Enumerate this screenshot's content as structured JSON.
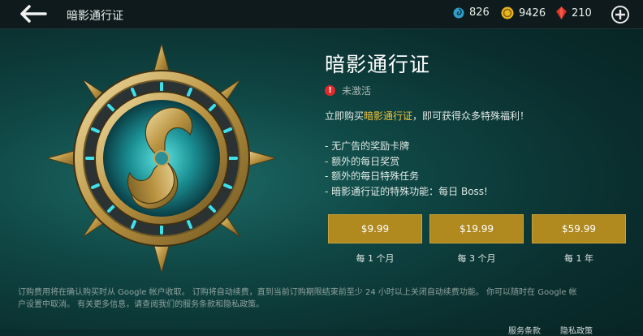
{
  "header": {
    "title": "暗影通行证",
    "currencies": [
      {
        "icon": "blue-swirl-icon",
        "value": "826"
      },
      {
        "icon": "gold-coin-icon",
        "value": "9426"
      },
      {
        "icon": "red-gem-icon",
        "value": "210"
      }
    ]
  },
  "pass": {
    "title": "暗影通行证",
    "status": "未激活",
    "desc_prefix": "立即购买",
    "desc_highlight": "暗影通行证",
    "desc_suffix": "，即可获得众多特殊福利！",
    "benefits": [
      "- 无广告的奖励卡牌",
      "- 额外的每日奖赏",
      "- 额外的每日特殊任务",
      "- 暗影通行证的特殊功能：每日 Boss!"
    ]
  },
  "plans": [
    {
      "price": "$9.99",
      "period": "每 1 个月"
    },
    {
      "price": "$19.99",
      "period": "每 3 个月"
    },
    {
      "price": "$59.99",
      "period": "每 1 年"
    }
  ],
  "legal": "订购费用将在确认购买时从 Google 帐户收取。 订购将自动续费，直到当前订购期限结束前至少 24 小时以上关闭自动续费功能。 你可以随时在 Google 帐户设置中取消。 有关更多信息，请查阅我们的服务条款和隐私政策。",
  "links": [
    "服务条款",
    "隐私政策"
  ],
  "colors": {
    "accent_gold": "#b0891f",
    "highlight": "#f1c33b",
    "status_red": "#e02a2a"
  }
}
